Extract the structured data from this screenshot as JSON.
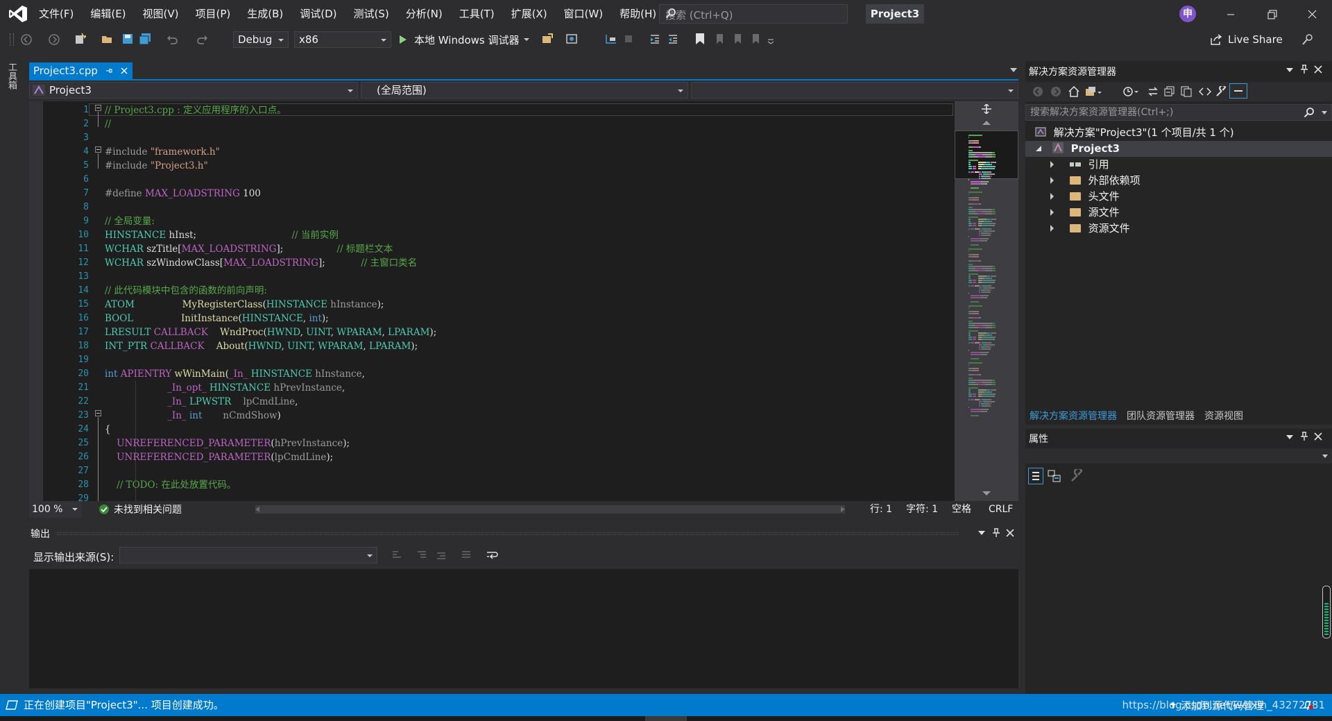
{
  "window": {
    "title": "Project3",
    "ime_indicator": "申",
    "menu": [
      "文件(F)",
      "编辑(E)",
      "视图(V)",
      "项目(P)",
      "生成(B)",
      "调试(D)",
      "测试(S)",
      "分析(N)",
      "工具(T)",
      "扩展(X)",
      "窗口(W)",
      "帮助(H)"
    ],
    "search_placeholder": "搜索 (Ctrl+Q)"
  },
  "toolbar": {
    "configuration": "Debug",
    "platform": "x86",
    "debugger_label": "本地 Windows 调试器",
    "live_share": "Live Share"
  },
  "toolbox_label": "工具箱",
  "editor": {
    "tab_label": "Project3.cpp",
    "nav_project": "Project3",
    "nav_scope": "(全局范围)",
    "zoom": "100 %",
    "issues": "未找到相关问题",
    "position": {
      "line": "行: 1",
      "char": "字符: 1",
      "spacing": "空格",
      "eol": "CRLF"
    },
    "line_numbers": [
      "1",
      "2",
      "3",
      "4",
      "5",
      "6",
      "7",
      "8",
      "9",
      "10",
      "11",
      "12",
      "13",
      "14",
      "15",
      "16",
      "17",
      "18",
      "19",
      "20",
      "21",
      "22",
      "23",
      "24",
      "25",
      "26",
      "27",
      "28",
      "29"
    ],
    "code": [
      [
        [
          "c-comment",
          "// Project3.cpp : 定义应用程序的入口点。"
        ]
      ],
      [
        [
          "c-comment",
          "//"
        ]
      ],
      [],
      [
        [
          "c-pre",
          "#include "
        ],
        [
          "c-str",
          "\"framework.h\""
        ]
      ],
      [
        [
          "c-pre",
          "#include "
        ],
        [
          "c-str",
          "\"Project3.h\""
        ]
      ],
      [],
      [
        [
          "c-pre",
          "#define "
        ],
        [
          "c-macro",
          "MAX_LOADSTRING"
        ],
        [
          "c-plain",
          " 100"
        ]
      ],
      [],
      [
        [
          "c-comment",
          "// 全局变量:"
        ]
      ],
      [
        [
          "c-type",
          "HINSTANCE"
        ],
        [
          "c-plain",
          " hInst;                                "
        ],
        [
          "c-comment",
          "// 当前实例"
        ]
      ],
      [
        [
          "c-type",
          "WCHAR"
        ],
        [
          "c-plain",
          " szTitle["
        ],
        [
          "c-macro",
          "MAX_LOADSTRING"
        ],
        [
          "c-plain",
          "];                  "
        ],
        [
          "c-comment",
          "// 标题栏文本"
        ]
      ],
      [
        [
          "c-type",
          "WCHAR"
        ],
        [
          "c-plain",
          " szWindowClass["
        ],
        [
          "c-macro",
          "MAX_LOADSTRING"
        ],
        [
          "c-plain",
          "];            "
        ],
        [
          "c-comment",
          "// 主窗口类名"
        ]
      ],
      [],
      [
        [
          "c-comment",
          "// 此代码模块中包含的函数的前向声明:"
        ]
      ],
      [
        [
          "c-type",
          "ATOM"
        ],
        [
          "c-plain",
          "                "
        ],
        [
          "c-fn",
          "MyRegisterClass"
        ],
        [
          "c-plain",
          "("
        ],
        [
          "c-type",
          "HINSTANCE"
        ],
        [
          "c-param",
          " hInstance"
        ],
        [
          "c-plain",
          ");"
        ]
      ],
      [
        [
          "c-type",
          "BOOL"
        ],
        [
          "c-plain",
          "                "
        ],
        [
          "c-fn",
          "InitInstance"
        ],
        [
          "c-plain",
          "("
        ],
        [
          "c-type",
          "HINSTANCE"
        ],
        [
          "c-plain",
          ", "
        ],
        [
          "c-kw",
          "int"
        ],
        [
          "c-plain",
          ");"
        ]
      ],
      [
        [
          "c-type",
          "LRESULT"
        ],
        [
          "c-plain",
          " "
        ],
        [
          "c-macro",
          "CALLBACK"
        ],
        [
          "c-plain",
          "    "
        ],
        [
          "c-fn",
          "WndProc"
        ],
        [
          "c-plain",
          "("
        ],
        [
          "c-type",
          "HWND"
        ],
        [
          "c-plain",
          ", "
        ],
        [
          "c-type",
          "UINT"
        ],
        [
          "c-plain",
          ", "
        ],
        [
          "c-type",
          "WPARAM"
        ],
        [
          "c-plain",
          ", "
        ],
        [
          "c-type",
          "LPARAM"
        ],
        [
          "c-plain",
          ");"
        ]
      ],
      [
        [
          "c-type",
          "INT_PTR"
        ],
        [
          "c-plain",
          " "
        ],
        [
          "c-macro",
          "CALLBACK"
        ],
        [
          "c-plain",
          "    "
        ],
        [
          "c-fn",
          "About"
        ],
        [
          "c-plain",
          "("
        ],
        [
          "c-type",
          "HWND"
        ],
        [
          "c-plain",
          ", "
        ],
        [
          "c-type",
          "UINT"
        ],
        [
          "c-plain",
          ", "
        ],
        [
          "c-type",
          "WPARAM"
        ],
        [
          "c-plain",
          ", "
        ],
        [
          "c-type",
          "LPARAM"
        ],
        [
          "c-plain",
          ");"
        ]
      ],
      [],
      [
        [
          "c-kw",
          "int"
        ],
        [
          "c-plain",
          " "
        ],
        [
          "c-macro",
          "APIENTRY"
        ],
        [
          "c-plain",
          " "
        ],
        [
          "c-fn",
          "wWinMain"
        ],
        [
          "c-plain",
          "("
        ],
        [
          "c-macro",
          "_In_"
        ],
        [
          "c-plain",
          " "
        ],
        [
          "c-type",
          "HINSTANCE"
        ],
        [
          "c-param",
          " hInstance"
        ],
        [
          "c-plain",
          ","
        ]
      ],
      [
        [
          "c-plain",
          "                     "
        ],
        [
          "c-macro",
          "_In_opt_"
        ],
        [
          "c-plain",
          " "
        ],
        [
          "c-type",
          "HINSTANCE"
        ],
        [
          "c-param",
          " hPrevInstance"
        ],
        [
          "c-plain",
          ","
        ]
      ],
      [
        [
          "c-plain",
          "                     "
        ],
        [
          "c-macro",
          "_In_"
        ],
        [
          "c-plain",
          " "
        ],
        [
          "c-type",
          "LPWSTR"
        ],
        [
          "c-param",
          "    lpCmdLine"
        ],
        [
          "c-plain",
          ","
        ]
      ],
      [
        [
          "c-plain",
          "                     "
        ],
        [
          "c-macro",
          "_In_"
        ],
        [
          "c-plain",
          " "
        ],
        [
          "c-kw",
          "int"
        ],
        [
          "c-param",
          "       nCmdShow"
        ],
        [
          "c-plain",
          ")"
        ]
      ],
      [
        [
          "c-plain",
          "{"
        ]
      ],
      [
        [
          "c-plain",
          "    "
        ],
        [
          "c-macro",
          "UNREFERENCED_PARAMETER"
        ],
        [
          "c-plain",
          "("
        ],
        [
          "c-param",
          "hPrevInstance"
        ],
        [
          "c-plain",
          ");"
        ]
      ],
      [
        [
          "c-plain",
          "    "
        ],
        [
          "c-macro",
          "UNREFERENCED_PARAMETER"
        ],
        [
          "c-plain",
          "("
        ],
        [
          "c-param",
          "lpCmdLine"
        ],
        [
          "c-plain",
          ");"
        ]
      ],
      [],
      [
        [
          "c-plain",
          "    "
        ],
        [
          "c-comment",
          "// TODO: 在此处放置代码。"
        ]
      ],
      []
    ]
  },
  "output_panel": {
    "title": "输出",
    "source_label": "显示输出来源(S):",
    "source_value": ""
  },
  "solution_explorer": {
    "title": "解决方案资源管理器",
    "search_placeholder": "搜索解决方案资源管理器(Ctrl+;)",
    "solution_label": "解决方案\"Project3\"(1 个项目/共 1 个)",
    "project_label": "Project3",
    "nodes": [
      "引用",
      "外部依赖项",
      "头文件",
      "源文件",
      "资源文件"
    ],
    "tabs": [
      "解决方案资源管理器",
      "团队资源管理器",
      "资源视图"
    ]
  },
  "properties": {
    "title": "属性"
  },
  "statusbar": {
    "message": "正在创建项目\"Project3\"... 项目创建成功。",
    "source_control": "添加到源代码管理",
    "watermark": "https://blog.csdn.net/weixin_43272781"
  },
  "colors": {
    "accent": "#007acc",
    "background": "#2d2d30",
    "editor_bg": "#1e1e1e",
    "vs_purple": "#865fc5"
  }
}
